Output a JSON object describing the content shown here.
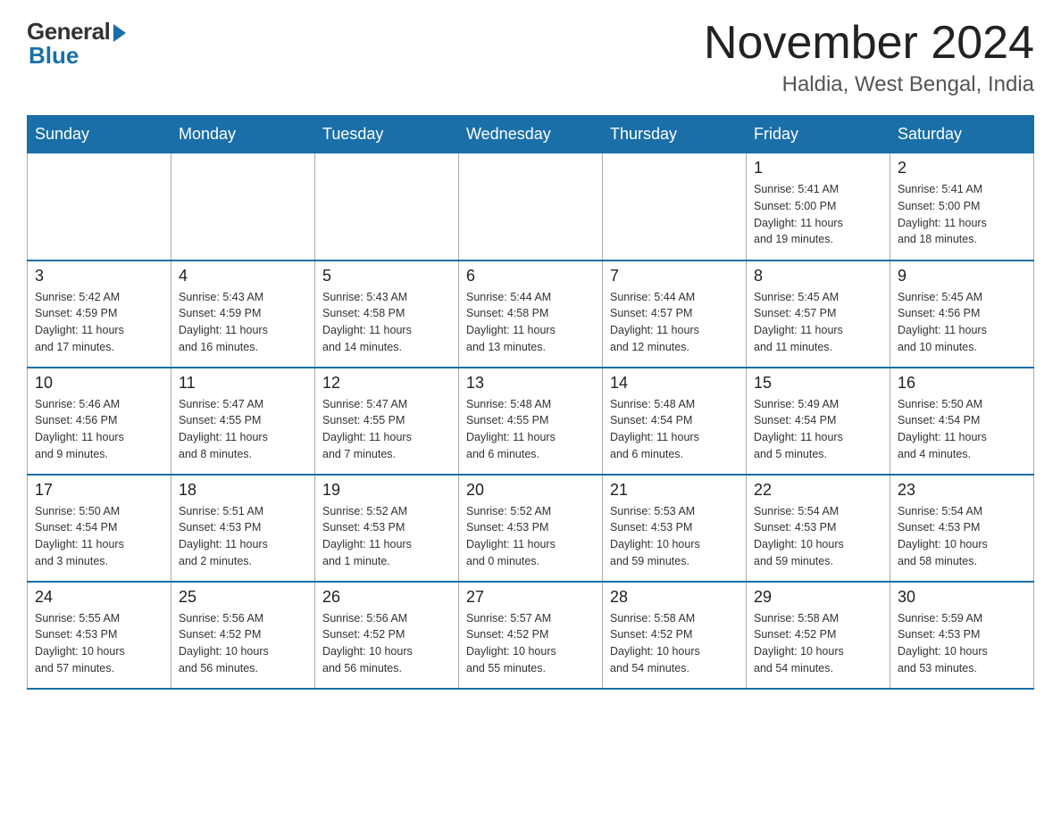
{
  "header": {
    "logo_general": "General",
    "logo_blue": "Blue",
    "month_title": "November 2024",
    "location": "Haldia, West Bengal, India"
  },
  "weekdays": [
    "Sunday",
    "Monday",
    "Tuesday",
    "Wednesday",
    "Thursday",
    "Friday",
    "Saturday"
  ],
  "weeks": [
    [
      {
        "day": "",
        "info": ""
      },
      {
        "day": "",
        "info": ""
      },
      {
        "day": "",
        "info": ""
      },
      {
        "day": "",
        "info": ""
      },
      {
        "day": "",
        "info": ""
      },
      {
        "day": "1",
        "info": "Sunrise: 5:41 AM\nSunset: 5:00 PM\nDaylight: 11 hours\nand 19 minutes."
      },
      {
        "day": "2",
        "info": "Sunrise: 5:41 AM\nSunset: 5:00 PM\nDaylight: 11 hours\nand 18 minutes."
      }
    ],
    [
      {
        "day": "3",
        "info": "Sunrise: 5:42 AM\nSunset: 4:59 PM\nDaylight: 11 hours\nand 17 minutes."
      },
      {
        "day": "4",
        "info": "Sunrise: 5:43 AM\nSunset: 4:59 PM\nDaylight: 11 hours\nand 16 minutes."
      },
      {
        "day": "5",
        "info": "Sunrise: 5:43 AM\nSunset: 4:58 PM\nDaylight: 11 hours\nand 14 minutes."
      },
      {
        "day": "6",
        "info": "Sunrise: 5:44 AM\nSunset: 4:58 PM\nDaylight: 11 hours\nand 13 minutes."
      },
      {
        "day": "7",
        "info": "Sunrise: 5:44 AM\nSunset: 4:57 PM\nDaylight: 11 hours\nand 12 minutes."
      },
      {
        "day": "8",
        "info": "Sunrise: 5:45 AM\nSunset: 4:57 PM\nDaylight: 11 hours\nand 11 minutes."
      },
      {
        "day": "9",
        "info": "Sunrise: 5:45 AM\nSunset: 4:56 PM\nDaylight: 11 hours\nand 10 minutes."
      }
    ],
    [
      {
        "day": "10",
        "info": "Sunrise: 5:46 AM\nSunset: 4:56 PM\nDaylight: 11 hours\nand 9 minutes."
      },
      {
        "day": "11",
        "info": "Sunrise: 5:47 AM\nSunset: 4:55 PM\nDaylight: 11 hours\nand 8 minutes."
      },
      {
        "day": "12",
        "info": "Sunrise: 5:47 AM\nSunset: 4:55 PM\nDaylight: 11 hours\nand 7 minutes."
      },
      {
        "day": "13",
        "info": "Sunrise: 5:48 AM\nSunset: 4:55 PM\nDaylight: 11 hours\nand 6 minutes."
      },
      {
        "day": "14",
        "info": "Sunrise: 5:48 AM\nSunset: 4:54 PM\nDaylight: 11 hours\nand 6 minutes."
      },
      {
        "day": "15",
        "info": "Sunrise: 5:49 AM\nSunset: 4:54 PM\nDaylight: 11 hours\nand 5 minutes."
      },
      {
        "day": "16",
        "info": "Sunrise: 5:50 AM\nSunset: 4:54 PM\nDaylight: 11 hours\nand 4 minutes."
      }
    ],
    [
      {
        "day": "17",
        "info": "Sunrise: 5:50 AM\nSunset: 4:54 PM\nDaylight: 11 hours\nand 3 minutes."
      },
      {
        "day": "18",
        "info": "Sunrise: 5:51 AM\nSunset: 4:53 PM\nDaylight: 11 hours\nand 2 minutes."
      },
      {
        "day": "19",
        "info": "Sunrise: 5:52 AM\nSunset: 4:53 PM\nDaylight: 11 hours\nand 1 minute."
      },
      {
        "day": "20",
        "info": "Sunrise: 5:52 AM\nSunset: 4:53 PM\nDaylight: 11 hours\nand 0 minutes."
      },
      {
        "day": "21",
        "info": "Sunrise: 5:53 AM\nSunset: 4:53 PM\nDaylight: 10 hours\nand 59 minutes."
      },
      {
        "day": "22",
        "info": "Sunrise: 5:54 AM\nSunset: 4:53 PM\nDaylight: 10 hours\nand 59 minutes."
      },
      {
        "day": "23",
        "info": "Sunrise: 5:54 AM\nSunset: 4:53 PM\nDaylight: 10 hours\nand 58 minutes."
      }
    ],
    [
      {
        "day": "24",
        "info": "Sunrise: 5:55 AM\nSunset: 4:53 PM\nDaylight: 10 hours\nand 57 minutes."
      },
      {
        "day": "25",
        "info": "Sunrise: 5:56 AM\nSunset: 4:52 PM\nDaylight: 10 hours\nand 56 minutes."
      },
      {
        "day": "26",
        "info": "Sunrise: 5:56 AM\nSunset: 4:52 PM\nDaylight: 10 hours\nand 56 minutes."
      },
      {
        "day": "27",
        "info": "Sunrise: 5:57 AM\nSunset: 4:52 PM\nDaylight: 10 hours\nand 55 minutes."
      },
      {
        "day": "28",
        "info": "Sunrise: 5:58 AM\nSunset: 4:52 PM\nDaylight: 10 hours\nand 54 minutes."
      },
      {
        "day": "29",
        "info": "Sunrise: 5:58 AM\nSunset: 4:52 PM\nDaylight: 10 hours\nand 54 minutes."
      },
      {
        "day": "30",
        "info": "Sunrise: 5:59 AM\nSunset: 4:53 PM\nDaylight: 10 hours\nand 53 minutes."
      }
    ]
  ]
}
